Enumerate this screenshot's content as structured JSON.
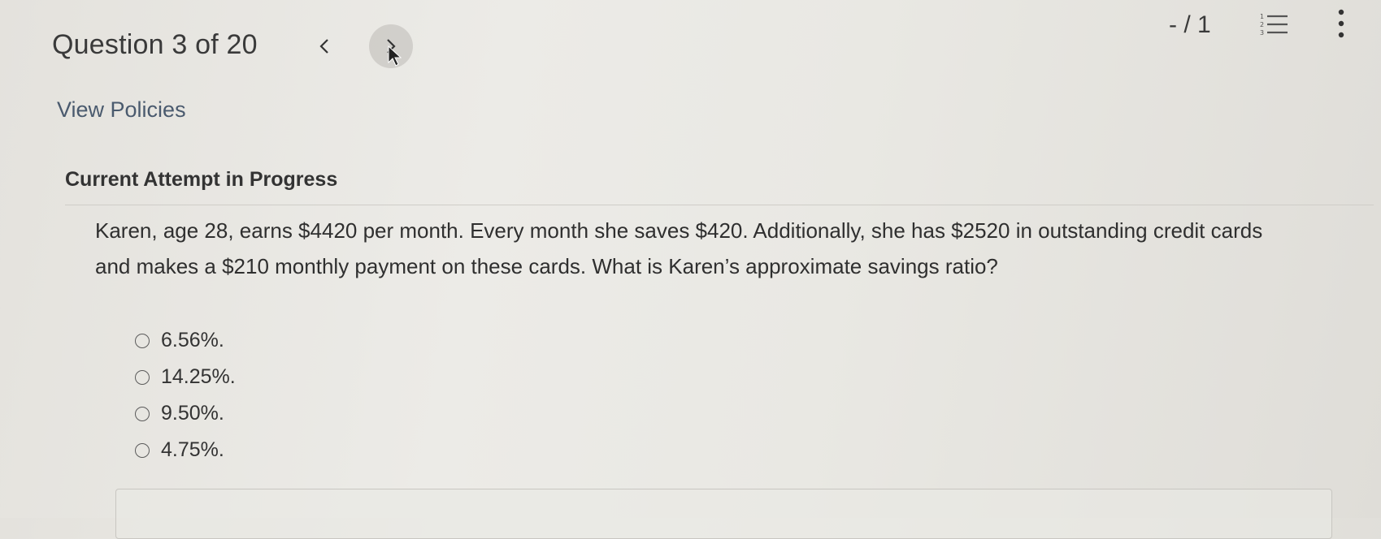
{
  "header": {
    "question_counter": "Question 3 of 20",
    "score": "- / 1",
    "prev_glyph": "<",
    "next_glyph": ">"
  },
  "policies_link": "View Policies",
  "attempt_title": "Current Attempt in Progress",
  "question": {
    "text": "Karen, age 28, earns $4420 per month. Every month she saves $420. Additionally, she has $2520 in outstanding credit cards and makes a $210 monthly payment on these cards. What is Karen’s approximate savings ratio?"
  },
  "options": [
    {
      "label": "6.56%."
    },
    {
      "label": "14.25%."
    },
    {
      "label": "9.50%."
    },
    {
      "label": "4.75%."
    }
  ],
  "icons": {
    "prev": "chevron-left-icon",
    "next": "chevron-right-icon",
    "list": "numbered-list-icon",
    "more": "more-vertical-icon",
    "cursor": "mouse-pointer-icon"
  },
  "colors": {
    "link": "#4a5a6e",
    "text": "#2f2f2f",
    "background": "#e9e8e3"
  }
}
